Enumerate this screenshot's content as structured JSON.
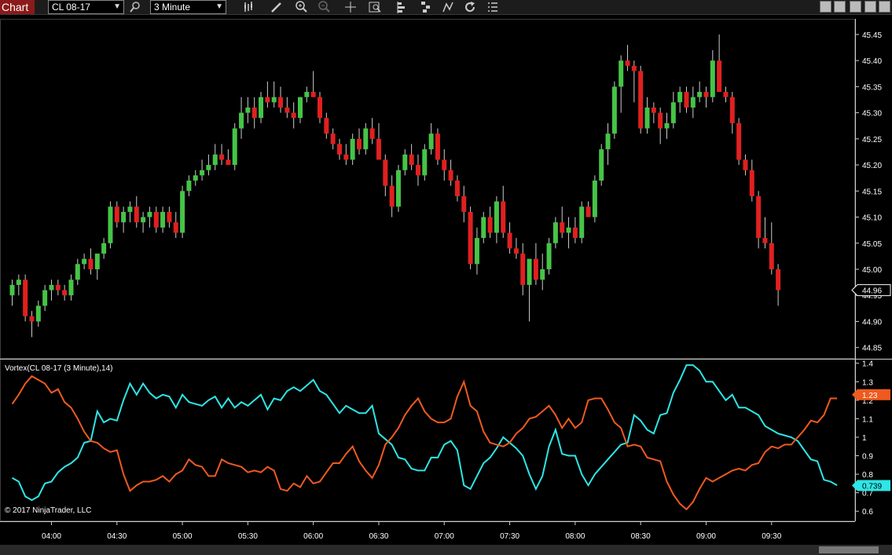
{
  "toolbar": {
    "chart_tab": "Chart",
    "instrument": "CL 08-17",
    "interval": "3 Minute",
    "icons": [
      "search-icon",
      "bar-type-icon",
      "pencil-icon",
      "zoom-in-icon",
      "zoom-out-icon",
      "crosshair-icon",
      "data-box-icon",
      "strategies-icon",
      "indicators-icon",
      "drawing-tools-icon",
      "reload-icon",
      "properties-icon"
    ]
  },
  "colors": {
    "background": "#000000",
    "up_candle": "#45c447",
    "down_candle": "#e02020",
    "wick": "#cccccc",
    "vi_plus": "#2ee6e6",
    "vi_minus": "#f05a1e",
    "price_marker": "#ffffff"
  },
  "copyright": "© 2017 NinjaTrader, LLC",
  "indicator": {
    "label": "Vortex(CL 08-17 (3 Minute),14)",
    "vi_minus_last": "1.23",
    "vi_plus_last": "0.739"
  },
  "price_marker": "44.96",
  "chart_data": [
    {
      "type": "candlestick",
      "title": "CL 08-17",
      "interval": "3 Minute",
      "ylim": [
        44.83,
        45.48
      ],
      "y_ticks": [
        "45.45",
        "45.40",
        "45.35",
        "45.30",
        "45.25",
        "45.20",
        "45.15",
        "45.10",
        "45.05",
        "45.00",
        "44.95",
        "44.90",
        "44.85"
      ],
      "x_ticks": [
        "04:00",
        "04:30",
        "05:00",
        "05:30",
        "06:00",
        "06:30",
        "07:00",
        "07:30",
        "08:00",
        "08:30",
        "09:00",
        "09:30"
      ],
      "x_tick_index": [
        6,
        16,
        26,
        36,
        46,
        56,
        66,
        76,
        86,
        96,
        106,
        116
      ],
      "last_price": 44.96,
      "ohlc": [
        [
          44.95,
          44.98,
          44.93,
          44.97
        ],
        [
          44.97,
          44.99,
          44.95,
          44.98
        ],
        [
          44.98,
          44.99,
          44.9,
          44.91
        ],
        [
          44.91,
          44.92,
          44.87,
          44.9
        ],
        [
          44.9,
          44.94,
          44.89,
          44.93
        ],
        [
          44.93,
          44.97,
          44.92,
          44.96
        ],
        [
          44.96,
          44.98,
          44.94,
          44.97
        ],
        [
          44.97,
          44.98,
          44.95,
          44.96
        ],
        [
          44.96,
          44.97,
          44.94,
          44.95
        ],
        [
          44.95,
          44.99,
          44.94,
          44.98
        ],
        [
          44.98,
          45.02,
          44.97,
          45.01
        ],
        [
          45.01,
          45.03,
          45.0,
          45.02
        ],
        [
          45.02,
          45.04,
          44.99,
          45.0
        ],
        [
          45.0,
          45.03,
          44.98,
          45.03
        ],
        [
          45.03,
          45.06,
          45.02,
          45.05
        ],
        [
          45.05,
          45.13,
          45.04,
          45.12
        ],
        [
          45.12,
          45.13,
          45.08,
          45.09
        ],
        [
          45.09,
          45.12,
          45.07,
          45.11
        ],
        [
          45.11,
          45.13,
          45.09,
          45.12
        ],
        [
          45.12,
          45.14,
          45.08,
          45.09
        ],
        [
          45.09,
          45.11,
          45.07,
          45.1
        ],
        [
          45.1,
          45.12,
          45.08,
          45.11
        ],
        [
          45.11,
          45.12,
          45.07,
          45.08
        ],
        [
          45.08,
          45.12,
          45.07,
          45.11
        ],
        [
          45.11,
          45.12,
          45.08,
          45.09
        ],
        [
          45.09,
          45.11,
          45.06,
          45.07
        ],
        [
          45.07,
          45.16,
          45.06,
          45.15
        ],
        [
          45.15,
          45.18,
          45.14,
          45.17
        ],
        [
          45.17,
          45.19,
          45.16,
          45.18
        ],
        [
          45.18,
          45.21,
          45.17,
          45.19
        ],
        [
          45.19,
          45.22,
          45.18,
          45.2
        ],
        [
          45.2,
          45.24,
          45.19,
          45.22
        ],
        [
          45.22,
          45.24,
          45.2,
          45.21
        ],
        [
          45.21,
          45.23,
          45.2,
          45.2
        ],
        [
          45.2,
          45.28,
          45.19,
          45.27
        ],
        [
          45.27,
          45.33,
          45.25,
          45.3
        ],
        [
          45.3,
          45.33,
          45.28,
          45.31
        ],
        [
          45.31,
          45.33,
          45.27,
          45.29
        ],
        [
          45.29,
          45.34,
          45.28,
          45.33
        ],
        [
          45.33,
          45.36,
          45.31,
          45.32
        ],
        [
          45.32,
          45.36,
          45.31,
          45.33
        ],
        [
          45.33,
          45.35,
          45.3,
          45.31
        ],
        [
          45.31,
          45.33,
          45.29,
          45.3
        ],
        [
          45.3,
          45.32,
          45.27,
          45.29
        ],
        [
          45.29,
          45.33,
          45.28,
          45.33
        ],
        [
          45.33,
          45.35,
          45.32,
          45.34
        ],
        [
          45.34,
          45.38,
          45.33,
          45.33
        ],
        [
          45.33,
          45.34,
          45.28,
          45.29
        ],
        [
          45.29,
          45.3,
          45.25,
          45.26
        ],
        [
          45.26,
          45.27,
          45.23,
          45.24
        ],
        [
          45.24,
          45.25,
          45.21,
          45.22
        ],
        [
          45.22,
          45.24,
          45.2,
          45.21
        ],
        [
          45.21,
          45.26,
          45.2,
          45.25
        ],
        [
          45.25,
          45.27,
          45.22,
          45.23
        ],
        [
          45.23,
          45.28,
          45.22,
          45.27
        ],
        [
          45.27,
          45.29,
          45.24,
          45.25
        ],
        [
          45.25,
          45.28,
          45.21,
          45.21
        ],
        [
          45.21,
          45.22,
          45.14,
          45.16
        ],
        [
          45.16,
          45.18,
          45.1,
          45.12
        ],
        [
          45.12,
          45.2,
          45.11,
          45.19
        ],
        [
          45.19,
          45.23,
          45.18,
          45.22
        ],
        [
          45.22,
          45.24,
          45.19,
          45.2
        ],
        [
          45.2,
          45.22,
          45.16,
          45.18
        ],
        [
          45.18,
          45.24,
          45.17,
          45.23
        ],
        [
          45.23,
          45.28,
          45.22,
          45.26
        ],
        [
          45.26,
          45.27,
          45.2,
          45.21
        ],
        [
          45.21,
          45.23,
          45.17,
          45.19
        ],
        [
          45.19,
          45.21,
          45.16,
          45.17
        ],
        [
          45.17,
          45.18,
          45.13,
          45.14
        ],
        [
          45.14,
          45.16,
          45.09,
          45.11
        ],
        [
          45.11,
          45.12,
          45.0,
          45.01
        ],
        [
          45.01,
          45.08,
          44.99,
          45.06
        ],
        [
          45.06,
          45.11,
          45.05,
          45.1
        ],
        [
          45.1,
          45.12,
          45.06,
          45.07
        ],
        [
          45.07,
          45.14,
          45.05,
          45.13
        ],
        [
          45.13,
          45.16,
          45.06,
          45.07
        ],
        [
          45.07,
          45.09,
          45.03,
          45.04
        ],
        [
          45.04,
          45.06,
          45.02,
          45.03
        ],
        [
          45.03,
          45.05,
          44.95,
          44.97
        ],
        [
          44.97,
          45.02,
          44.9,
          45.02
        ],
        [
          45.02,
          45.05,
          44.97,
          44.98
        ],
        [
          44.98,
          45.03,
          44.96,
          45.0
        ],
        [
          45.0,
          45.06,
          44.99,
          45.05
        ],
        [
          45.05,
          45.1,
          45.04,
          45.09
        ],
        [
          45.09,
          45.12,
          45.06,
          45.07
        ],
        [
          45.07,
          45.1,
          45.04,
          45.08
        ],
        [
          45.08,
          45.1,
          45.05,
          45.06
        ],
        [
          45.06,
          45.13,
          45.05,
          45.12
        ],
        [
          45.12,
          45.13,
          45.1,
          45.1
        ],
        [
          45.1,
          45.18,
          45.09,
          45.17
        ],
        [
          45.17,
          45.24,
          45.16,
          45.23
        ],
        [
          45.23,
          45.28,
          45.2,
          45.26
        ],
        [
          45.26,
          45.36,
          45.25,
          45.35
        ],
        [
          45.35,
          45.41,
          45.3,
          45.4
        ],
        [
          45.4,
          45.43,
          45.38,
          45.39
        ],
        [
          45.39,
          45.4,
          45.32,
          45.38
        ],
        [
          45.38,
          45.39,
          45.26,
          45.27
        ],
        [
          45.27,
          45.33,
          45.26,
          45.31
        ],
        [
          45.31,
          45.32,
          45.28,
          45.3
        ],
        [
          45.3,
          45.31,
          45.24,
          45.27
        ],
        [
          45.27,
          45.3,
          45.25,
          45.28
        ],
        [
          45.28,
          45.34,
          45.27,
          45.32
        ],
        [
          45.32,
          45.35,
          45.3,
          45.34
        ],
        [
          45.34,
          45.35,
          45.3,
          45.31
        ],
        [
          45.31,
          45.35,
          45.29,
          45.33
        ],
        [
          45.33,
          45.36,
          45.32,
          45.34
        ],
        [
          45.34,
          45.35,
          45.31,
          45.33
        ],
        [
          45.33,
          45.42,
          45.32,
          45.4
        ],
        [
          45.4,
          45.45,
          45.38,
          45.34
        ],
        [
          45.34,
          45.35,
          45.32,
          45.33
        ],
        [
          45.33,
          45.34,
          45.26,
          45.28
        ],
        [
          45.28,
          45.29,
          45.2,
          45.21
        ],
        [
          45.21,
          45.22,
          45.18,
          45.19
        ],
        [
          45.19,
          45.21,
          45.13,
          45.14
        ],
        [
          45.14,
          45.15,
          45.04,
          45.06
        ],
        [
          45.06,
          45.1,
          45.04,
          45.05
        ],
        [
          45.05,
          45.09,
          44.99,
          45.0
        ],
        [
          45.0,
          45.01,
          44.93,
          44.96
        ]
      ]
    },
    {
      "type": "line",
      "title": "Vortex(CL 08-17 (3 Minute),14)",
      "ylim": [
        0.55,
        1.42
      ],
      "y_ticks": [
        "1.4",
        "1.3",
        "1.2",
        "1.1",
        "1",
        "0.9",
        "0.8",
        "0.7",
        "0.6"
      ],
      "series": [
        {
          "name": "VI+",
          "last": 0.739,
          "values": [
            0.78,
            0.76,
            0.68,
            0.66,
            0.68,
            0.75,
            0.76,
            0.81,
            0.84,
            0.86,
            0.89,
            0.97,
            0.98,
            1.14,
            1.08,
            1.1,
            1.09,
            1.2,
            1.29,
            1.23,
            1.29,
            1.24,
            1.21,
            1.23,
            1.22,
            1.16,
            1.23,
            1.19,
            1.18,
            1.17,
            1.2,
            1.22,
            1.16,
            1.21,
            1.16,
            1.19,
            1.17,
            1.2,
            1.23,
            1.15,
            1.21,
            1.2,
            1.25,
            1.27,
            1.25,
            1.28,
            1.31,
            1.25,
            1.23,
            1.18,
            1.13,
            1.17,
            1.15,
            1.13,
            1.13,
            1.17,
            1.02,
            0.99,
            0.96,
            0.89,
            0.88,
            0.83,
            0.82,
            0.82,
            0.89,
            0.89,
            0.96,
            0.98,
            0.93,
            0.74,
            0.72,
            0.79,
            0.86,
            0.89,
            0.94,
            1.0,
            0.97,
            0.94,
            0.9,
            0.8,
            0.72,
            0.79,
            0.95,
            1.04,
            0.91,
            0.9,
            0.9,
            0.8,
            0.74,
            0.8,
            0.84,
            0.88,
            0.92,
            0.96,
            0.97,
            1.12,
            1.09,
            1.04,
            1.02,
            1.12,
            1.13,
            1.24,
            1.31,
            1.39,
            1.39,
            1.36,
            1.3,
            1.3,
            1.25,
            1.2,
            1.23,
            1.16,
            1.16,
            1.14,
            1.12,
            1.06,
            1.04,
            1.02,
            1.01,
            1.0,
            0.98,
            0.93,
            0.88,
            0.87,
            0.77,
            0.76,
            0.74
          ]
        },
        {
          "name": "VI-",
          "last": 1.23,
          "values": [
            1.18,
            1.23,
            1.29,
            1.33,
            1.31,
            1.29,
            1.24,
            1.26,
            1.19,
            1.16,
            1.1,
            1.03,
            0.98,
            0.97,
            0.94,
            0.92,
            0.93,
            0.8,
            0.71,
            0.74,
            0.76,
            0.76,
            0.77,
            0.79,
            0.76,
            0.8,
            0.82,
            0.88,
            0.85,
            0.84,
            0.79,
            0.79,
            0.88,
            0.86,
            0.85,
            0.84,
            0.81,
            0.82,
            0.81,
            0.84,
            0.82,
            0.72,
            0.71,
            0.75,
            0.73,
            0.79,
            0.75,
            0.76,
            0.81,
            0.86,
            0.86,
            0.91,
            0.95,
            0.87,
            0.82,
            0.78,
            0.85,
            0.96,
            1.0,
            1.05,
            1.12,
            1.17,
            1.21,
            1.14,
            1.1,
            1.08,
            1.08,
            1.1,
            1.22,
            1.3,
            1.17,
            1.14,
            1.03,
            0.97,
            0.96,
            0.95,
            0.97,
            1.02,
            1.05,
            1.1,
            1.11,
            1.14,
            1.17,
            1.12,
            1.05,
            1.1,
            1.05,
            1.08,
            1.2,
            1.21,
            1.21,
            1.15,
            1.08,
            1.05,
            0.95,
            0.96,
            0.95,
            0.89,
            0.88,
            0.87,
            0.76,
            0.69,
            0.64,
            0.61,
            0.65,
            0.72,
            0.78,
            0.76,
            0.78,
            0.8,
            0.82,
            0.83,
            0.82,
            0.85,
            0.86,
            0.92,
            0.95,
            0.94,
            0.96,
            0.96,
            1.0,
            1.04,
            1.09,
            1.08,
            1.12,
            1.21,
            1.21
          ]
        }
      ]
    }
  ]
}
